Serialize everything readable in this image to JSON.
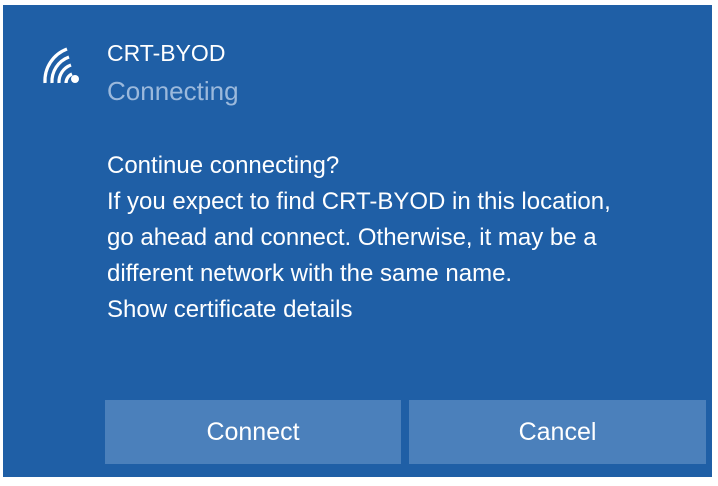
{
  "network": {
    "icon": "wifi-secured-icon",
    "name": "CRT-BYOD",
    "status": "Connecting",
    "status_color": "#9bb9dc"
  },
  "message": {
    "heading": "Continue connecting?",
    "lines": [
      "If you expect to find CRT-BYOD in this location,",
      "go ahead and connect. Otherwise, it may be a",
      "different network with the same name."
    ],
    "certificate_link": "Show certificate details"
  },
  "buttons": {
    "connect_label": "Connect",
    "cancel_label": "Cancel"
  },
  "colors": {
    "panel_background": "#1f5fa6",
    "button_background": "#4b80bb",
    "text": "#ffffff"
  }
}
